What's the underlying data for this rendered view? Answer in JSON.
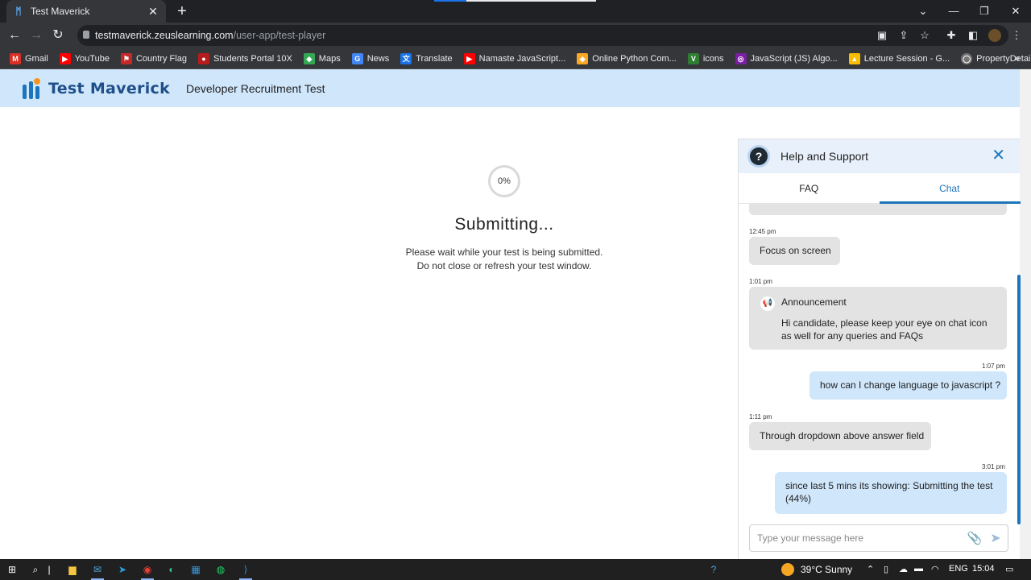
{
  "browser": {
    "tab_title": "Test Maverick",
    "tab_close": "✕",
    "new_tab": "+",
    "url_host": "testmaverick.zeuslearning.com",
    "url_path": "/user-app/test-player",
    "bookmarks": [
      "Gmail",
      "YouTube",
      "Country Flag",
      "Students Portal 10X",
      "Maps",
      "News",
      "Translate",
      "Namaste JavaScript...",
      "Online Python Com...",
      "icons",
      "JavaScript (JS) Algo...",
      "Lecture Session - G...",
      "PropertyDetails.css"
    ],
    "bookmarks_more": "»"
  },
  "header": {
    "logo_text": "Test Maverick",
    "test_name": "Developer Recruitment Test"
  },
  "submission": {
    "progress_label": "0%",
    "progress_fraction": 0,
    "title": "Submitting...",
    "line1": "Please wait while your test is being submitted.",
    "line2": "Do not close or refresh your test window."
  },
  "help": {
    "title": "Help and Support",
    "tabs": [
      "FAQ",
      "Chat"
    ],
    "active_tab": "Chat",
    "composer_placeholder": "Type your message here",
    "messages": [
      {
        "time": "12:45 pm",
        "text": "Focus on screen",
        "dir": "in"
      },
      {
        "time": "1:01 pm",
        "heading": "Announcement",
        "text": "Hi candidate, please keep your eye on chat icon as well for any queries and FAQs",
        "dir": "in"
      },
      {
        "time": "1:07 pm",
        "text": "how can I change language to javascript ?",
        "dir": "out"
      },
      {
        "time": "1:11 pm",
        "text": "Through dropdown above answer field",
        "dir": "in"
      },
      {
        "time": "3:01 pm",
        "text": "since last 5 mins its showing: Submitting the test (44%)",
        "dir": "out"
      }
    ]
  },
  "taskbar": {
    "weather": "39°C  Sunny",
    "language": "ENG",
    "clock": "15:04"
  },
  "colors": {
    "accent": "#1c75bc",
    "header_bg": "#cfe6fb",
    "bubble_in": "#e3e3e3",
    "bubble_out": "#cfe6fb"
  }
}
